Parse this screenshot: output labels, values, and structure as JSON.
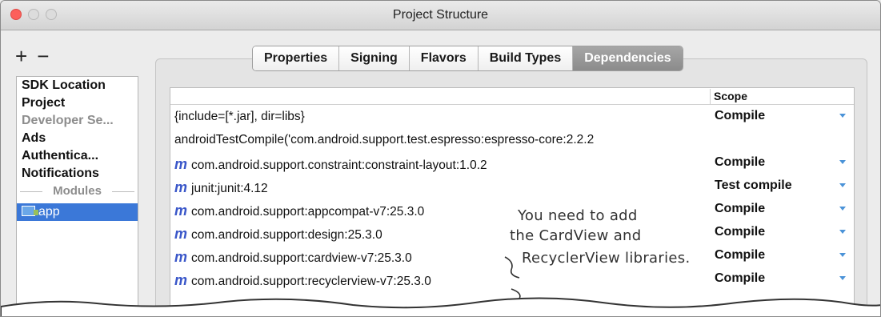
{
  "window": {
    "title": "Project Structure"
  },
  "sidebar": {
    "add_icon": "+",
    "remove_icon": "−",
    "items": [
      {
        "label": "SDK Location"
      },
      {
        "label": "Project"
      },
      {
        "label": "Developer Se..."
      },
      {
        "label": "Ads"
      },
      {
        "label": "Authentica..."
      },
      {
        "label": "Notifications"
      }
    ],
    "modules_label": "Modules",
    "module": "app"
  },
  "tabs": [
    {
      "label": "Properties"
    },
    {
      "label": "Signing"
    },
    {
      "label": "Flavors"
    },
    {
      "label": "Build Types"
    },
    {
      "label": "Dependencies"
    }
  ],
  "table": {
    "scope_header": "Scope",
    "m_icon": "m",
    "rows": [
      {
        "dependency": "{include=[*.jar], dir=libs}",
        "scope": "Compile"
      },
      {
        "dependency": "androidTestCompile('com.android.support.test.espresso:espresso-core:2.2.2",
        "scope": ""
      },
      {
        "dependency": "com.android.support.constraint:constraint-layout:1.0.2",
        "scope": "Compile"
      },
      {
        "dependency": "junit:junit:4.12",
        "scope": "Test compile"
      },
      {
        "dependency": "com.android.support:appcompat-v7:25.3.0",
        "scope": "Compile"
      },
      {
        "dependency": "com.android.support:design:25.3.0",
        "scope": "Compile"
      },
      {
        "dependency": "com.android.support:cardview-v7:25.3.0",
        "scope": "Compile"
      },
      {
        "dependency": "com.android.support:recyclerview-v7:25.3.0",
        "scope": "Compile"
      }
    ]
  },
  "annotation": {
    "line1": "You need to add",
    "line2": "the CardView and",
    "line3": "RecyclerView libraries."
  },
  "colors": {
    "selection": "#3b78d8",
    "m_icon": "#3a57c9",
    "scope_arrow": "#4b93d8"
  }
}
